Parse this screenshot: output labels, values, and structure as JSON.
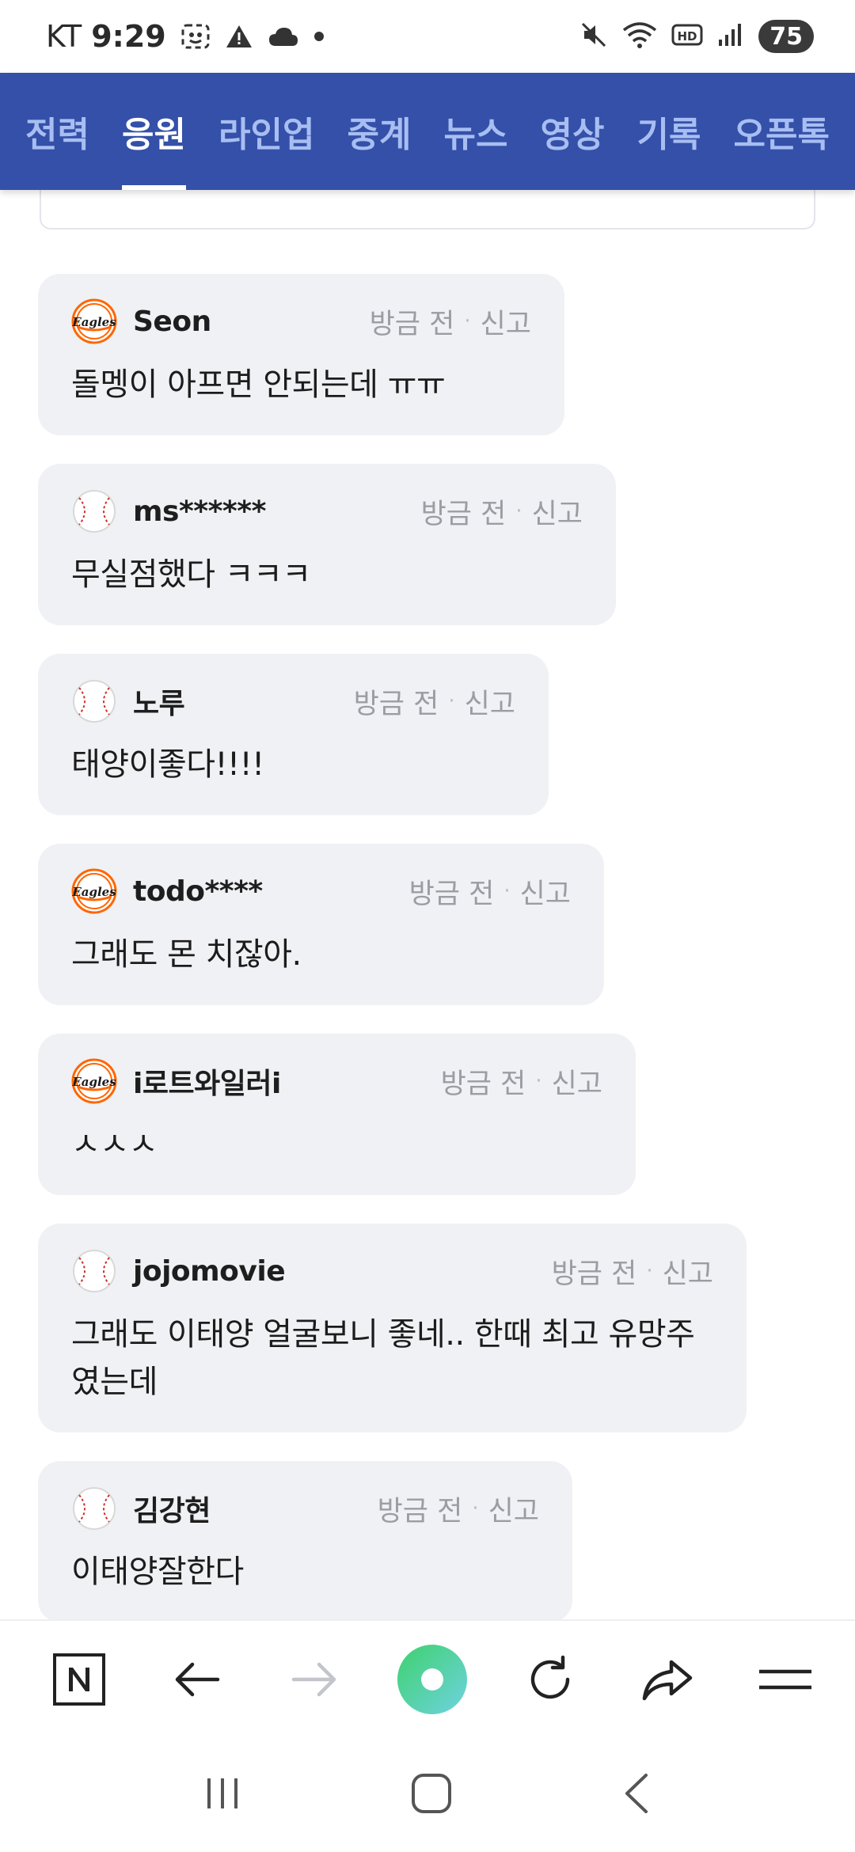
{
  "status_bar": {
    "carrier": "KT",
    "time": "9:29",
    "battery": "75",
    "icons": [
      "screenshot-icon",
      "warning-icon",
      "cloud-icon",
      "dot-icon",
      "mute-icon",
      "wifi-icon",
      "hd-icon",
      "signal-icon"
    ]
  },
  "tabs": [
    {
      "label": "전력",
      "active": false
    },
    {
      "label": "응원",
      "active": true
    },
    {
      "label": "라인업",
      "active": false
    },
    {
      "label": "중계",
      "active": false
    },
    {
      "label": "뉴스",
      "active": false
    },
    {
      "label": "영상",
      "active": false
    },
    {
      "label": "기록",
      "active": false
    },
    {
      "label": "오픈톡",
      "active": false
    }
  ],
  "comments": [
    {
      "nick": "Seon",
      "time": "방금 전",
      "report": "신고",
      "text": "돌멩이 아프면 안되는데 ㅠㅠ",
      "avatar": "eagles-logo"
    },
    {
      "nick": "ms******",
      "time": "방금 전",
      "report": "신고",
      "text": "무실점했다 ㅋㅋㅋ",
      "avatar": "baseball"
    },
    {
      "nick": "노루",
      "time": "방금 전",
      "report": "신고",
      "text": "태양이좋다!!!!",
      "avatar": "baseball"
    },
    {
      "nick": "todo****",
      "time": "방금 전",
      "report": "신고",
      "text": "그래도 몬 치잖아.",
      "avatar": "eagles-logo"
    },
    {
      "nick": "i로트와일러i",
      "time": "방금 전",
      "report": "신고",
      "text": "ㅅㅅㅅ",
      "avatar": "eagles-logo"
    },
    {
      "nick": "jojomovie",
      "time": "방금 전",
      "report": "신고",
      "text": "그래도 이태양 얼굴보니 좋네.. 한때 최고 유망주였는데",
      "avatar": "baseball"
    },
    {
      "nick": "김강현",
      "time": "방금 전",
      "report": "신고",
      "text": "이태양잘한다",
      "avatar": "baseball"
    }
  ],
  "toolbar": {
    "items": [
      "naver-n-icon",
      "back-arrow-icon",
      "forward-arrow-icon",
      "green-dot-icon",
      "refresh-icon",
      "share-icon",
      "menu-icon"
    ]
  },
  "colors": {
    "tab_bg": "#3450a8",
    "tab_active": "#ffffff",
    "tab_inactive": "#a8bef2",
    "bubble_bg": "#f0f1f4",
    "meta_text": "#9a9da3",
    "eagles_orange": "#ff6600"
  }
}
